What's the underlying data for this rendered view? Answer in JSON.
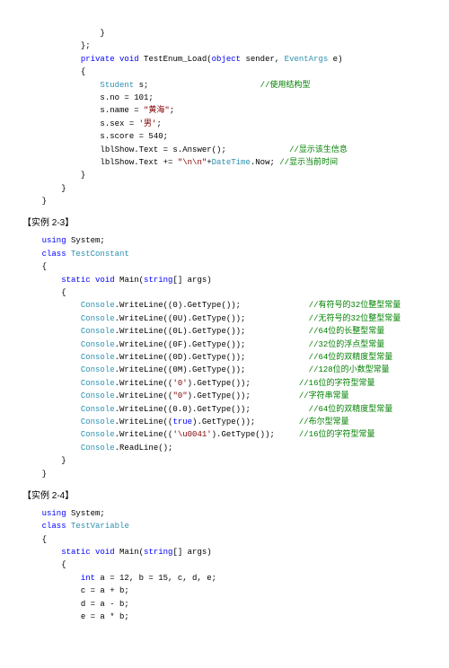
{
  "block1": {
    "l1": "}",
    "l2": "};",
    "l3a": "private",
    "l3b": "void",
    "l3c": " TestEnum_Load(",
    "l3d": "object",
    "l3e": " sender, ",
    "l3f": "EventArgs",
    "l3g": " e)",
    "l4": "{",
    "l5a": "Student",
    "l5b": " s;",
    "l5c": "//使用结构型",
    "l6": "s.no = 101;",
    "l7a": "s.name = ",
    "l7b": "\"黄海\"",
    "l7c": ";",
    "l8a": "s.sex = ",
    "l8b": "'男'",
    "l8c": ";",
    "l9": "s.score = 540;",
    "l10a": "lblShow.Text = s.Answer();",
    "l10b": "//显示该生信息",
    "l11a": "lblShow.Text += ",
    "l11b": "\"\\n\\n\"",
    "l11c": "+",
    "l11d": "DateTime",
    "l11e": ".Now;",
    "l11f": " //显示当前时间",
    "l12": "}",
    "l13": "}",
    "l14": "}"
  },
  "hdr23": "【实例 2-3】",
  "block2": {
    "l1a": "using",
    "l1b": " System;",
    "l2a": "class",
    "l2b": "TestConstant",
    "l3": "{",
    "l4a": "static",
    "l4b": "void",
    "l4c": " Main(",
    "l4d": "string",
    "l4e": "[] args)",
    "l5": "{",
    "r1a": "Console",
    "r1b": ".WriteLine((0).GetType());",
    "r1c": "//有符号的32位整型常量",
    "r2a": "Console",
    "r2b": ".WriteLine((0U).GetType());",
    "r2c": "//无符号的32位整型常量",
    "r3a": "Console",
    "r3b": ".WriteLine((0L).GetType());",
    "r3c": "//64位的长整型常量",
    "r4a": "Console",
    "r4b": ".WriteLine((0F).GetType());",
    "r4c": "//32位的浮点型常量",
    "r5a": "Console",
    "r5b": ".WriteLine((0D).GetType());",
    "r5c": "//64位的双精度型常量",
    "r6a": "Console",
    "r6b": ".WriteLine((0M).GetType());",
    "r6c": "//128位的小数型常量",
    "r7a": "Console",
    "r7b": ".WriteLine((",
    "r7s": "'0'",
    "r7b2": ").GetType());",
    "r7c": "//16位的字符型常量",
    "r8a": "Console",
    "r8b": ".WriteLine((",
    "r8s": "\"0\"",
    "r8b2": ").GetType());",
    "r8c": "//字符串常量",
    "r9a": "Console",
    "r9b": ".WriteLine((0.0).GetType());",
    "r9c": "//64位的双精度型常量",
    "r10a": "Console",
    "r10b": ".WriteLine((",
    "r10kw": "true",
    "r10b2": ").GetType());",
    "r10c": "//布尔型常量",
    "r11a": "Console",
    "r11b": ".WriteLine((",
    "r11s": "'\\u0041'",
    "r11b2": ").GetType());",
    "r11c": "//16位的字符型常量",
    "r12a": "Console",
    "r12b": ".ReadLine();",
    "l6": "}",
    "l7": "}"
  },
  "hdr24": "【实例 2-4】",
  "block3": {
    "l1a": "using",
    "l1b": " System;",
    "l2a": "class",
    "l2b": "TestVariable",
    "l3": "{",
    "l4a": "static",
    "l4b": "void",
    "l4c": " Main(",
    "l4d": "string",
    "l4e": "[] args)",
    "l5": "{",
    "l6a": "int",
    "l6b": " a = 12, b = 15, c, d, e;",
    "l7": "c = a + b;",
    "l8": "d = a - b;",
    "l9": "e = a * b;"
  }
}
